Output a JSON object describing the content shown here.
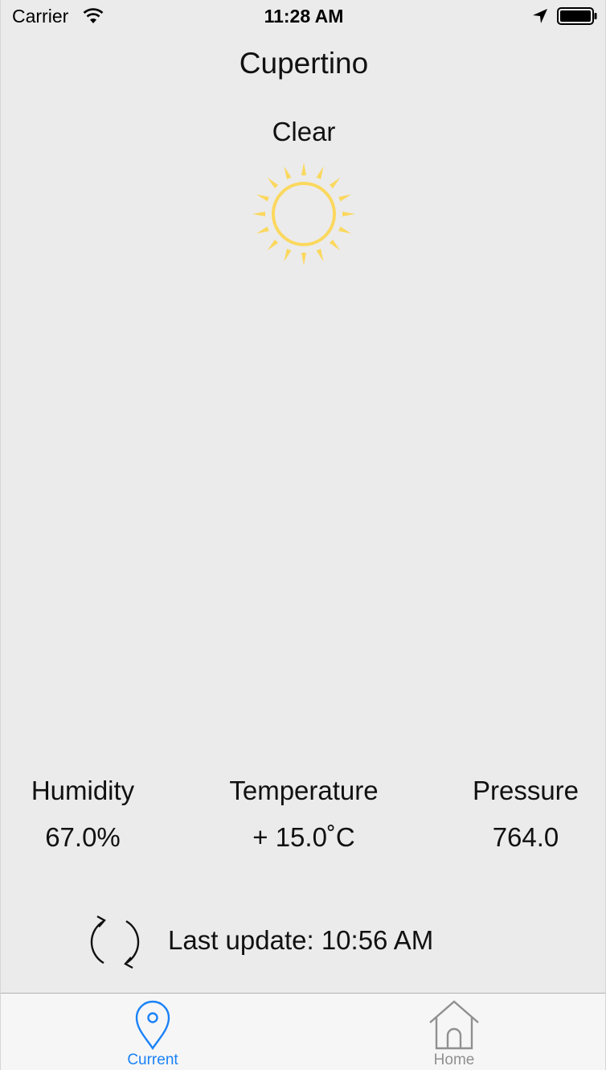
{
  "status_bar": {
    "carrier": "Carrier",
    "time": "11:28 AM",
    "icons": [
      "wifi-icon",
      "location-arrow-icon",
      "battery-icon"
    ]
  },
  "weather": {
    "city": "Cupertino",
    "condition": "Clear",
    "condition_icon": "sun-icon",
    "sun_color": "#FBD85E"
  },
  "stats": {
    "humidity": {
      "label": "Humidity",
      "value": "67.0%"
    },
    "temperature": {
      "label": "Temperature",
      "value": "+ 15.0˚C"
    },
    "pressure": {
      "label": "Pressure",
      "value": "764.0"
    }
  },
  "refresh": {
    "icon": "refresh-icon",
    "last_update_label": "Last update:",
    "last_update_time": "10:56 AM"
  },
  "tab_bar": {
    "tabs": [
      {
        "label": "Current",
        "icon": "location-pin-icon",
        "selected": true,
        "color": "#1A82F7"
      },
      {
        "label": "Home",
        "icon": "house-icon",
        "selected": false,
        "color": "#909090"
      }
    ]
  }
}
